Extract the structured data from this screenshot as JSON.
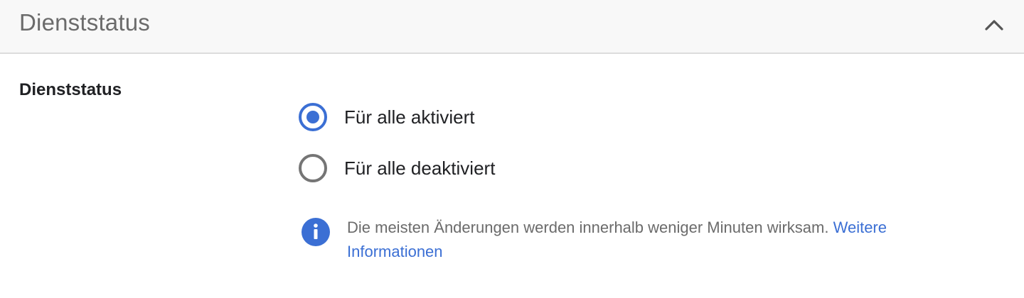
{
  "header": {
    "title": "Dienststatus",
    "collapse_icon": "chevron-up-icon"
  },
  "section": {
    "label": "Dienststatus"
  },
  "options": [
    {
      "label": "Für alle aktiviert",
      "selected": true
    },
    {
      "label": "Für alle deaktiviert",
      "selected": false
    }
  ],
  "info": {
    "icon": "info-icon",
    "text": "Die meisten Änderungen werden innerhalb weniger Minuten wirksam. ",
    "link_label": "Weitere Informationen"
  },
  "colors": {
    "accent": "#3b6fd4",
    "header_bg": "#f8f8f8",
    "muted_text": "#6b6b6b",
    "radio_unselected": "#757575"
  }
}
